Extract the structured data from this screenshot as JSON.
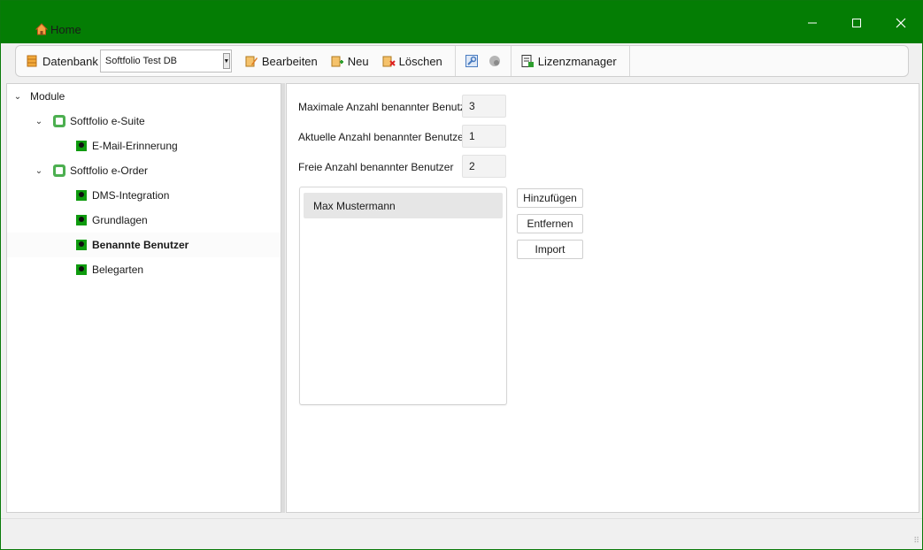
{
  "window": {
    "title": "Home",
    "accent_color": "#047d04",
    "controls": {
      "minimize": "minimize-icon",
      "maximize": "maximize-icon",
      "close": "close-icon"
    }
  },
  "toolbar": {
    "database_label": "Datenbank",
    "database_value": "Softfolio Test DB",
    "edit_label": "Bearbeiten",
    "new_label": "Neu",
    "delete_label": "Löschen",
    "license_label": "Lizenzmanager"
  },
  "tree": {
    "root": "Module",
    "groups": [
      {
        "label": "Softfolio e-Suite",
        "children": [
          "E-Mail-Erinnerung"
        ]
      },
      {
        "label": "Softfolio e-Order",
        "children": [
          "DMS-Integration",
          "Grundlagen",
          "Benannte Benutzer",
          "Belegarten"
        ]
      }
    ],
    "selected": "Benannte Benutzer"
  },
  "main": {
    "fields": [
      {
        "label": "Maximale Anzahl benannter Benutzer",
        "value": "3"
      },
      {
        "label": "Aktuelle Anzahl benannter Benutzer",
        "value": "1"
      },
      {
        "label": "Freie Anzahl benannter Benutzer",
        "value": "2"
      }
    ],
    "users": [
      "Max Mustermann"
    ],
    "buttons": {
      "add": "Hinzufügen",
      "remove": "Entfernen",
      "import": "Import"
    }
  }
}
